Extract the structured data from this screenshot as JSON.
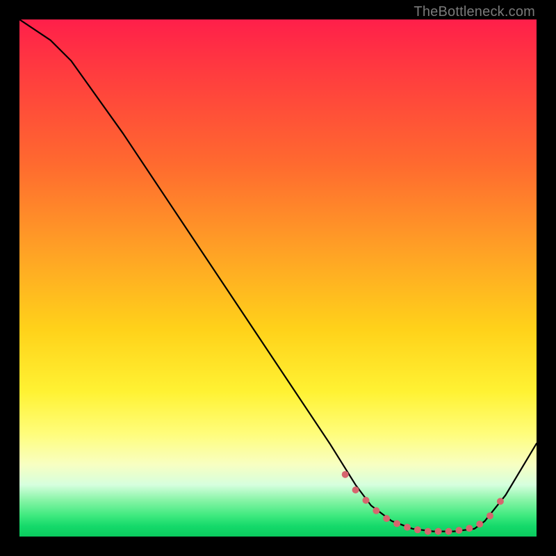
{
  "watermark": "TheBottleneck.com",
  "chart_data": {
    "type": "line",
    "title": "",
    "xlabel": "",
    "ylabel": "",
    "xlim": [
      0,
      100
    ],
    "ylim": [
      0,
      100
    ],
    "series": [
      {
        "name": "curve",
        "x": [
          0,
          6,
          10,
          20,
          30,
          40,
          50,
          60,
          65,
          68,
          72,
          76,
          80,
          84,
          88,
          90,
          94,
          100
        ],
        "y": [
          100,
          96,
          92,
          78,
          63,
          48,
          33,
          18,
          10,
          6,
          3,
          1.5,
          1,
          1,
          1.5,
          3,
          8,
          18
        ]
      }
    ],
    "markers": {
      "name": "selected-range",
      "color": "#d6666e",
      "x": [
        63,
        65,
        67,
        69,
        71,
        73,
        75,
        77,
        79,
        81,
        83,
        85,
        87,
        89,
        91,
        93
      ],
      "y": [
        12,
        9,
        7,
        5,
        3.5,
        2.5,
        1.8,
        1.3,
        1,
        1,
        1,
        1.2,
        1.6,
        2.4,
        4,
        6.8
      ]
    }
  }
}
